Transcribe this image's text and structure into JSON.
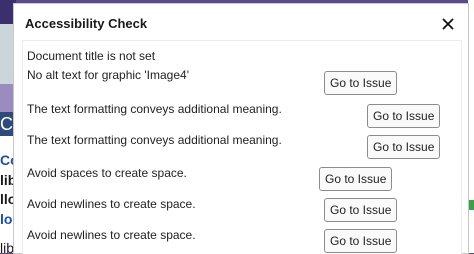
{
  "background": {
    "fragments": [
      "Co",
      "Col",
      "lib",
      "llo",
      "loc",
      "lib"
    ]
  },
  "dialog": {
    "title": "Accessibility Check",
    "close_icon": "close-icon",
    "issues": [
      {
        "text": "Document title is not set",
        "button": null
      },
      {
        "text": "No alt text for graphic 'Image4'",
        "button": "Go to Issue"
      },
      {
        "text": "The text formatting conveys additional meaning.",
        "button": "Go to Issue"
      },
      {
        "text": "The text formatting conveys additional meaning.",
        "button": "Go to Issue"
      },
      {
        "text": "Avoid spaces to create space.",
        "button": "Go to Issue"
      },
      {
        "text": "Avoid newlines to create space.",
        "button": "Go to Issue"
      },
      {
        "text": "Avoid newlines to create space.",
        "button": "Go to Issue"
      }
    ]
  }
}
